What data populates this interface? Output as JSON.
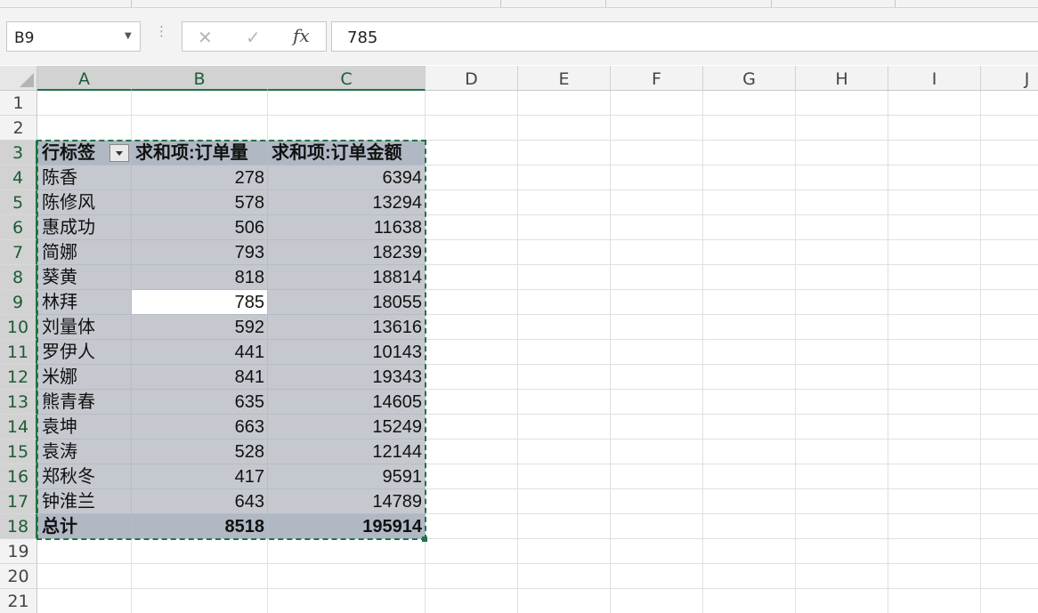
{
  "name_box": {
    "value": "B9"
  },
  "formula_bar": {
    "cancel_glyph": "✕",
    "enter_glyph": "✓",
    "fx_label": "fx",
    "value": "785"
  },
  "columns": [
    "A",
    "B",
    "C",
    "D",
    "E",
    "F",
    "G",
    "H",
    "I",
    "J"
  ],
  "selected_columns": [
    "A",
    "B",
    "C"
  ],
  "rows": [
    "1",
    "2",
    "3",
    "4",
    "5",
    "6",
    "7",
    "8",
    "9",
    "10",
    "11",
    "12",
    "13",
    "14",
    "15",
    "16",
    "17",
    "18",
    "19",
    "20",
    "21"
  ],
  "selected_rows": [
    "3",
    "4",
    "5",
    "6",
    "7",
    "8",
    "9",
    "10",
    "11",
    "12",
    "13",
    "14",
    "15",
    "16",
    "17",
    "18"
  ],
  "pivot": {
    "headers": [
      "行标签",
      "求和项:订单量",
      "求和项:订单金额"
    ],
    "rows": [
      {
        "label": "陈香",
        "qty": "278",
        "amount": "6394"
      },
      {
        "label": "陈修风",
        "qty": "578",
        "amount": "13294"
      },
      {
        "label": "惠成功",
        "qty": "506",
        "amount": "11638"
      },
      {
        "label": "简娜",
        "qty": "793",
        "amount": "18239"
      },
      {
        "label": "葵黄",
        "qty": "818",
        "amount": "18814"
      },
      {
        "label": "林拜",
        "qty": "785",
        "amount": "18055"
      },
      {
        "label": "刘量体",
        "qty": "592",
        "amount": "13616"
      },
      {
        "label": "罗伊人",
        "qty": "441",
        "amount": "10143"
      },
      {
        "label": "米娜",
        "qty": "841",
        "amount": "19343"
      },
      {
        "label": "熊青春",
        "qty": "635",
        "amount": "14605"
      },
      {
        "label": "袁坤",
        "qty": "663",
        "amount": "15249"
      },
      {
        "label": "袁涛",
        "qty": "528",
        "amount": "12144"
      },
      {
        "label": "郑秋冬",
        "qty": "417",
        "amount": "9591"
      },
      {
        "label": "钟淮兰",
        "qty": "643",
        "amount": "14789"
      }
    ],
    "total": {
      "label": "总计",
      "qty": "8518",
      "amount": "195914"
    }
  },
  "colors": {
    "accent": "#217346",
    "pivot_body": "#c5c9cf",
    "pivot_header": "#b0b8c4"
  }
}
